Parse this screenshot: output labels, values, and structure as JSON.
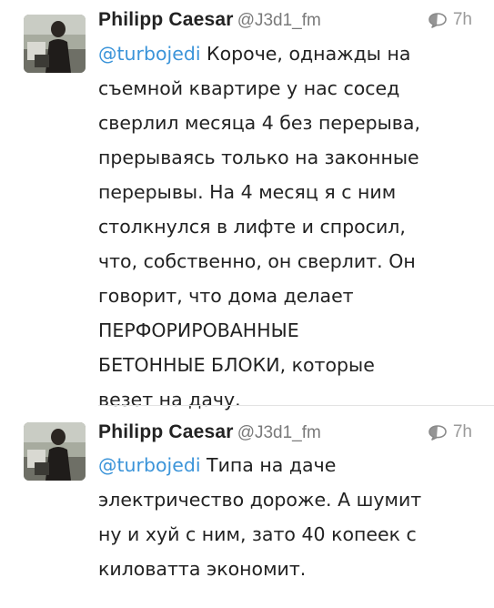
{
  "colors": {
    "mention": "#3b94d9",
    "text": "#222222",
    "handle": "#7a7a7a",
    "divider": "#e3e3e3"
  },
  "tweets": [
    {
      "author_name": "Philipp Caesar",
      "handle": "@J3d1_fm",
      "time": "7h",
      "icon": "reply-icon",
      "mention": "@turbojedi",
      "lines": [
        " Короче, однажды на",
        "съемной квартире у нас сосед",
        "сверлил месяца 4 без перерыва,",
        "прерываясь только на законные",
        "перерывы. На 4 месяц я с ним",
        "столкнулся в лифте и спросил,",
        "что, собственно, он сверлит. Он",
        "говорит, что дома делает",
        "ПЕРФОРИРОВАННЫЕ",
        "БЕТОННЫЕ БЛОКИ, которые",
        "везет на дачу."
      ]
    },
    {
      "author_name": "Philipp Caesar",
      "handle": "@J3d1_fm",
      "time": "7h",
      "icon": "reply-icon",
      "mention": "@turbojedi",
      "lines": [
        " Типа на даче",
        "электричество дороже. А шумит",
        "ну и хуй с ним, зато 40 копеек с",
        "киловатта экономит."
      ]
    }
  ]
}
